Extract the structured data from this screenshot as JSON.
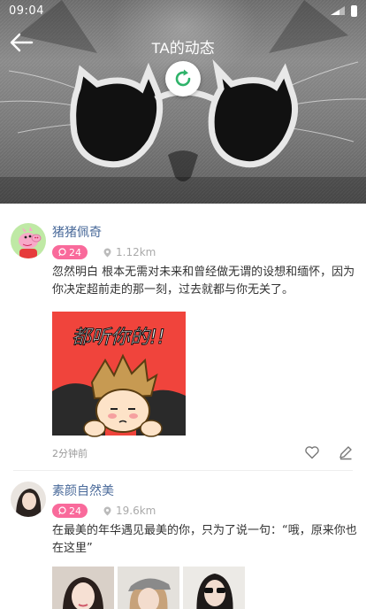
{
  "status_bar": {
    "time": "09:04"
  },
  "header": {
    "title": "TA的动态"
  },
  "icons": {
    "back": "arrow-left-icon",
    "refresh": "refresh-icon",
    "comment": "comment-icon",
    "location": "location-pin-icon",
    "like": "heart-icon",
    "edit": "pencil-icon"
  },
  "colors": {
    "badge": "#f96a9b",
    "name": "#4a6a9a",
    "refresh": "#2fb36a"
  },
  "posts": [
    {
      "author": "猪猪佩奇",
      "badge_count": "24",
      "distance": "1.12km",
      "content": "忽然明白 根本无需对未来和曾经做无谓的设想和缅怀，因为你决定超前走的那一刻，过去就都与你无关了。",
      "image_text": "都听你的!!",
      "time": "2分钟前"
    },
    {
      "author": "素颜自然美",
      "badge_count": "24",
      "distance": "19.6km",
      "content": "在最美的年华遇见最美的你，只为了说一句：“哦，原来你也在这里”"
    }
  ]
}
